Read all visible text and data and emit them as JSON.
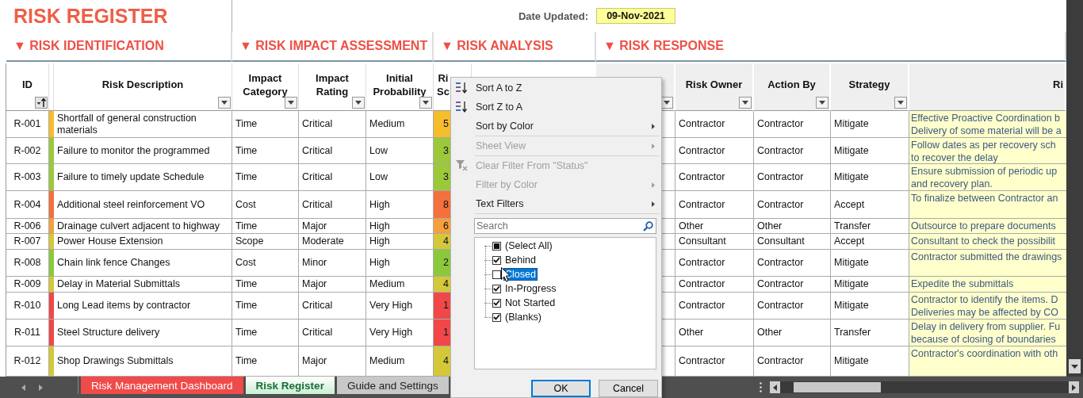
{
  "title": "RISK REGISTER",
  "date_label": "Date Updated:",
  "date_value": "09-Nov-2021",
  "sections": [
    {
      "label": "▼ RISK IDENTIFICATION"
    },
    {
      "label": "▼ RISK IMPACT ASSESSMENT"
    },
    {
      "label": "▼ RISK ANALYSIS"
    },
    {
      "label": "▼ RISK RESPONSE"
    }
  ],
  "columns": [
    {
      "label": "ID",
      "filter_button": true,
      "sorted": true
    },
    {
      "label": "Risk Description",
      "filter_button": true,
      "sorted": false
    },
    {
      "label": "Impact Category",
      "filter_button": true,
      "sorted": false
    },
    {
      "label": "Impact Rating",
      "filter_button": true,
      "sorted": false
    },
    {
      "label": "Initial Probability",
      "filter_button": true,
      "sorted": false
    },
    {
      "label": "Ri\nSc",
      "filter_button": false
    },
    {
      "filter_button": true,
      "sorted": false
    },
    {
      "label": "Risk Owner",
      "filter_button": true,
      "sorted": false
    },
    {
      "label": "Action By",
      "filter_button": true,
      "sorted": false
    },
    {
      "label": "Strategy",
      "filter_button": true,
      "sorted": false
    },
    {
      "label": "Ri",
      "filter_button": false
    }
  ],
  "rows": [
    {
      "id": "R-001",
      "color": "#f6bd2c",
      "description": "Shortfall of general construction materials",
      "impact_category": "Time",
      "impact_rating": "Critical",
      "initial_probability": "Medium",
      "score": "5",
      "risk_owner": "Contractor",
      "action_by": "Contractor",
      "strategy": "Mitigate",
      "response": "Effective Proactive Coordination b\nDelivery of some material will be a"
    },
    {
      "id": "R-002",
      "color": "#9cc83c",
      "description": "Failure to monitor the programmed",
      "impact_category": "Time",
      "impact_rating": "Critical",
      "initial_probability": "Low",
      "score": "3",
      "risk_owner": "Contractor",
      "action_by": "Contractor",
      "strategy": "Mitigate",
      "response": "Follow dates as per recovery sch\nto recover the delay"
    },
    {
      "id": "R-003",
      "color": "#9cc83c",
      "description": "Failure to timely update Schedule",
      "impact_category": "Time",
      "impact_rating": "Critical",
      "initial_probability": "Low",
      "score": "3",
      "risk_owner": "Contractor",
      "action_by": "Contractor",
      "strategy": "Mitigate",
      "response": "Ensure submission of periodic up\nand recovery plan."
    },
    {
      "id": "R-004",
      "color": "#f4703c",
      "description": "Additional steel reinforcement VO",
      "impact_category": "Cost",
      "impact_rating": "Critical",
      "initial_probability": "High",
      "score": "8",
      "risk_owner": "Contractor",
      "action_by": "Contractor",
      "strategy": "Accept",
      "response": "To finalize between Contractor an"
    },
    {
      "id": "R-006",
      "color": "#f5a03a",
      "description": "Drainage culvert adjacent to highway",
      "impact_category": "Time",
      "impact_rating": "Major",
      "initial_probability": "High",
      "score": "6",
      "risk_owner": "Other",
      "action_by": "Other",
      "strategy": "Transfer",
      "response": "Outsource to prepare documents"
    },
    {
      "id": "R-007",
      "color": "#d4c83a",
      "description": "Power House Extension",
      "impact_category": "Scope",
      "impact_rating": "Moderate",
      "initial_probability": "High",
      "score": "4",
      "risk_owner": "Consultant",
      "action_by": "Consultant",
      "strategy": "Accept",
      "response": "Consultant to check the possibilit"
    },
    {
      "id": "R-008",
      "color": "#8cc83c",
      "description": "Chain link fence Changes",
      "impact_category": "Cost",
      "impact_rating": "Minor",
      "initial_probability": "High",
      "score": "2",
      "risk_owner": "Contractor",
      "action_by": "Contractor",
      "strategy": "Mitigate",
      "response": "Contractor submitted the drawings"
    },
    {
      "id": "R-009",
      "color": "#d4c83a",
      "description": "Delay in Material Submittals",
      "impact_category": "Time",
      "impact_rating": "Major",
      "initial_probability": "Medium",
      "score": "4",
      "risk_owner": "Contractor",
      "action_by": "Contractor",
      "strategy": "Mitigate",
      "response": "Expedite the submittals"
    },
    {
      "id": "R-010",
      "color": "#f04848",
      "description": "Long Lead items by contractor",
      "impact_category": "Time",
      "impact_rating": "Critical",
      "initial_probability": "Very High",
      "score": "1",
      "risk_owner": "Contractor",
      "action_by": "Contractor",
      "strategy": "Mitigate",
      "response": "Contractor to identify the items. D\nDeliveries may be affected by CO"
    },
    {
      "id": "R-011",
      "color": "#f04848",
      "description": "Steel Structure delivery",
      "impact_category": "Time",
      "impact_rating": "Critical",
      "initial_probability": "Very High",
      "score": "1",
      "risk_owner": "Other",
      "action_by": "Other",
      "strategy": "Transfer",
      "response": "Delay in delivery from supplier. Fu\nbecause of closing of boundaries"
    },
    {
      "id": "R-012",
      "color": "#d4c83a",
      "description": "Shop Drawings Submittals",
      "impact_category": "Time",
      "impact_rating": "Major",
      "initial_probability": "Medium",
      "score": "4",
      "risk_owner": "Contractor",
      "action_by": "Contractor",
      "strategy": "Mitigate",
      "response": "Contractor's coordination with oth"
    }
  ],
  "filter_menu": {
    "items": [
      {
        "label": "Sort A to Z",
        "kind": "sort_asc",
        "disabled": false,
        "submenu": false
      },
      {
        "label": "Sort Z to A",
        "kind": "sort_desc",
        "disabled": false,
        "submenu": false
      },
      {
        "label": "Sort by Color",
        "kind": "plain",
        "disabled": false,
        "submenu": true
      },
      {
        "kind": "separator"
      },
      {
        "label": "Sheet View",
        "kind": "plain",
        "disabled": true,
        "submenu": true
      },
      {
        "kind": "separator"
      },
      {
        "label": "Clear Filter From \"Status\"",
        "kind": "clear_filter",
        "disabled": true,
        "submenu": false
      },
      {
        "label": "Filter by Color",
        "kind": "plain",
        "disabled": true,
        "submenu": true
      },
      {
        "label": "Text Filters",
        "kind": "plain",
        "disabled": false,
        "submenu": true
      },
      {
        "kind": "separator"
      }
    ],
    "search": {
      "placeholder": "Search"
    },
    "options": [
      {
        "label": "(Select All)",
        "checked": false,
        "indeterminate": true,
        "selected": false
      },
      {
        "label": "Behind",
        "checked": true,
        "indeterminate": false,
        "selected": false
      },
      {
        "label": "Closed",
        "checked": false,
        "indeterminate": false,
        "selected": true
      },
      {
        "label": "In-Progress",
        "checked": true,
        "indeterminate": false,
        "selected": false
      },
      {
        "label": "Not Started",
        "checked": true,
        "indeterminate": false,
        "selected": false
      },
      {
        "label": "(Blanks)",
        "checked": true,
        "indeterminate": false,
        "selected": false
      }
    ],
    "buttons": [
      "OK",
      "Cancel"
    ]
  },
  "sheet_tabs": [
    {
      "label": "Risk Management Dashboard",
      "selected": false,
      "color": "#f04b4b"
    },
    {
      "label": "Risk Register",
      "selected": true,
      "color": "#c8f0d4"
    },
    {
      "label": "Guide and Settings",
      "selected": false,
      "color": "#c8c8c8"
    }
  ]
}
